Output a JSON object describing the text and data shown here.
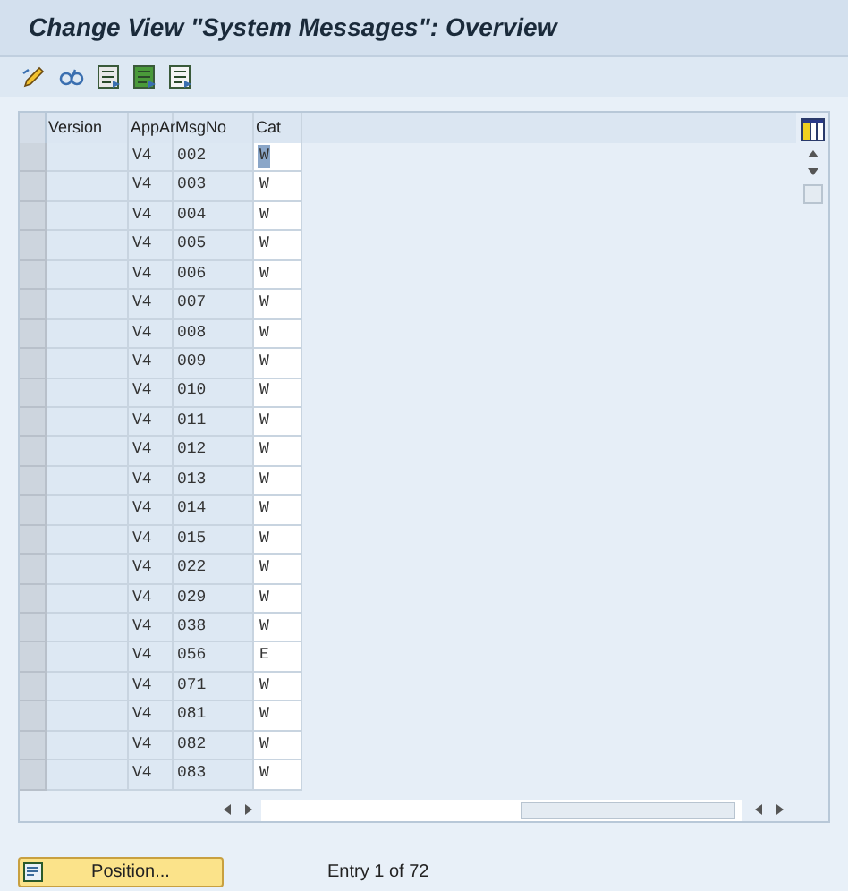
{
  "window": {
    "title": "Change View \"System Messages\": Overview"
  },
  "table": {
    "columns": [
      "Version",
      "AppAr",
      "MsgNo",
      "Cat"
    ],
    "rows": [
      {
        "appar": "V4",
        "msgno": "002",
        "cat": "W",
        "selected": true
      },
      {
        "appar": "V4",
        "msgno": "003",
        "cat": "W",
        "selected": false
      },
      {
        "appar": "V4",
        "msgno": "004",
        "cat": "W",
        "selected": false
      },
      {
        "appar": "V4",
        "msgno": "005",
        "cat": "W",
        "selected": false
      },
      {
        "appar": "V4",
        "msgno": "006",
        "cat": "W",
        "selected": false
      },
      {
        "appar": "V4",
        "msgno": "007",
        "cat": "W",
        "selected": false
      },
      {
        "appar": "V4",
        "msgno": "008",
        "cat": "W",
        "selected": false
      },
      {
        "appar": "V4",
        "msgno": "009",
        "cat": "W",
        "selected": false
      },
      {
        "appar": "V4",
        "msgno": "010",
        "cat": "W",
        "selected": false
      },
      {
        "appar": "V4",
        "msgno": "011",
        "cat": "W",
        "selected": false
      },
      {
        "appar": "V4",
        "msgno": "012",
        "cat": "W",
        "selected": false
      },
      {
        "appar": "V4",
        "msgno": "013",
        "cat": "W",
        "selected": false
      },
      {
        "appar": "V4",
        "msgno": "014",
        "cat": "W",
        "selected": false
      },
      {
        "appar": "V4",
        "msgno": "015",
        "cat": "W",
        "selected": false
      },
      {
        "appar": "V4",
        "msgno": "022",
        "cat": "W",
        "selected": false
      },
      {
        "appar": "V4",
        "msgno": "029",
        "cat": "W",
        "selected": false
      },
      {
        "appar": "V4",
        "msgno": "038",
        "cat": "W",
        "selected": false
      },
      {
        "appar": "V4",
        "msgno": "056",
        "cat": "E",
        "selected": false
      },
      {
        "appar": "V4",
        "msgno": "071",
        "cat": "W",
        "selected": false
      },
      {
        "appar": "V4",
        "msgno": "081",
        "cat": "W",
        "selected": false
      },
      {
        "appar": "V4",
        "msgno": "082",
        "cat": "W",
        "selected": false
      },
      {
        "appar": "V4",
        "msgno": "083",
        "cat": "W",
        "selected": false
      }
    ]
  },
  "footer": {
    "button": "Position...",
    "entry": "Entry 1 of 72"
  }
}
